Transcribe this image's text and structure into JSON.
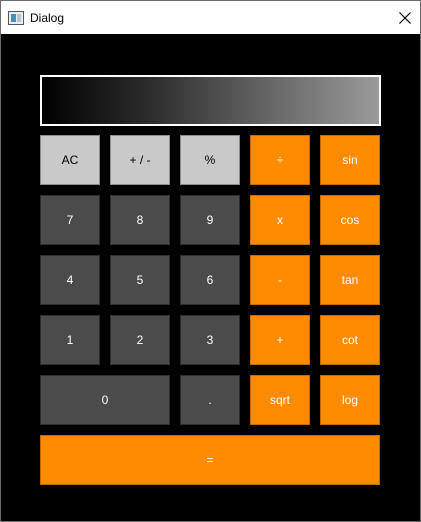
{
  "window": {
    "title": "Dialog"
  },
  "display": {
    "value": ""
  },
  "keys": {
    "ac": "AC",
    "plus_minus": "+ / -",
    "percent": "%",
    "divide": "÷",
    "sin": "sin",
    "seven": "7",
    "eight": "8",
    "nine": "9",
    "multiply": "x",
    "cos": "cos",
    "four": "4",
    "five": "5",
    "six": "6",
    "minus": "-",
    "tan": "tan",
    "one": "1",
    "two": "2",
    "three": "3",
    "plus": "+",
    "cot": "cot",
    "zero": "0",
    "dot": ".",
    "sqrt": "sqrt",
    "log": "log",
    "equals": "="
  },
  "colors": {
    "background": "#000000",
    "operator": "#ff8c00",
    "digit": "#4b4b4b",
    "function": "#c9c9c9"
  }
}
